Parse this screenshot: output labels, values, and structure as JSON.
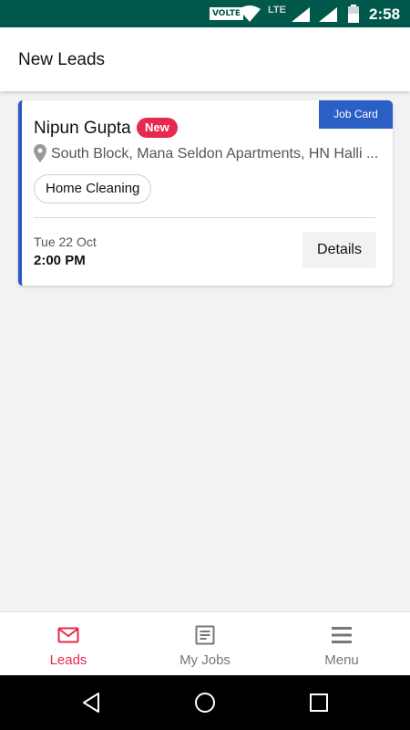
{
  "status_bar": {
    "volte": "VOLTE",
    "network": "LTE",
    "time": "2:58"
  },
  "app_bar": {
    "title": "New Leads"
  },
  "lead": {
    "job_card_label": "Job Card",
    "customer_name": "Nipun Gupta",
    "badge": "New",
    "address": "South Block, Mana Seldon Apartments, HN Halli ...",
    "service": "Home Cleaning",
    "date": "Tue 22 Oct",
    "time": "2:00 PM",
    "details_label": "Details"
  },
  "bottom_nav": {
    "items": [
      {
        "label": "Leads",
        "icon": "mail-icon",
        "active": true
      },
      {
        "label": "My Jobs",
        "icon": "document-icon",
        "active": false
      },
      {
        "label": "Menu",
        "icon": "hamburger-icon",
        "active": false
      }
    ]
  },
  "colors": {
    "status_bar": "#00594a",
    "accent": "#e8284e",
    "job_card": "#2c5fc6"
  }
}
